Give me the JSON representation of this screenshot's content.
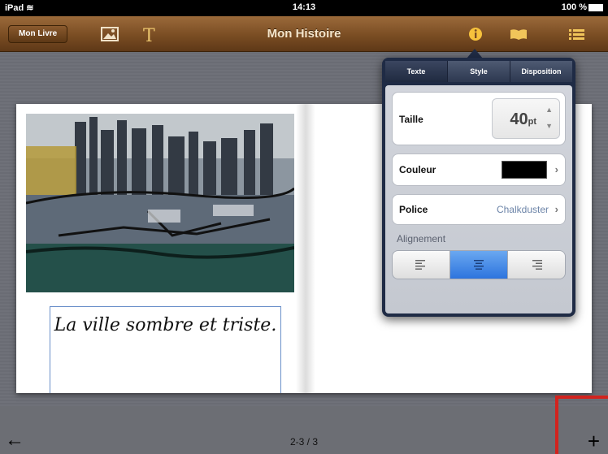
{
  "status": {
    "carrier": "iPad",
    "time": "14:13",
    "battery": "100 %"
  },
  "toolbar": {
    "left_button": "Mon Livre",
    "title": "Mon Histoire"
  },
  "page": {
    "caption": "La ville sombre et triste."
  },
  "popover": {
    "tabs": [
      "Texte",
      "Style",
      "Disposition"
    ],
    "active_tab": "Texte",
    "size_label": "Taille",
    "size_value": "40",
    "size_unit": "pt",
    "color_label": "Couleur",
    "color_value": "#000000",
    "font_label": "Police",
    "font_value": "Chalkduster",
    "alignment_label": "Alignement",
    "alignment_selected": "center"
  },
  "footer": {
    "page_indicator": "2-3 / 3"
  },
  "colors": {
    "toolbar": "#7a4d23",
    "highlight": "#d2231e",
    "selected": "#2d74de"
  }
}
